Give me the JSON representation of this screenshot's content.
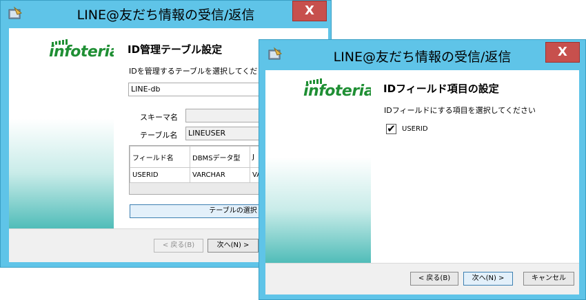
{
  "back_window": {
    "title": "LINE@友だち情報の受信/返信",
    "close_label": "X",
    "logo_text": "infoteria",
    "heading": "ID管理テーブル設定",
    "instruction": "IDを管理するテーブルを選択してくだ",
    "db_value": "LINE-db",
    "schema_label": "スキーマ名",
    "schema_value": "",
    "table_label": "テーブル名",
    "table_value": "LINEUSER",
    "grid": {
      "headers": [
        "フィールド名",
        "DBMSデータ型",
        "J"
      ],
      "rows": [
        [
          "USERID",
          "VARCHAR",
          "VA"
        ]
      ]
    },
    "select_table_button": "テーブルの選択",
    "back_button": "< 戻る(B)",
    "next_button": "次へ(N) >"
  },
  "front_window": {
    "title": "LINE@友だち情報の受信/返信",
    "close_label": "X",
    "logo_text": "infoteria",
    "heading": "IDフィールド項目の設定",
    "instruction": "IDフィールドにする項目を選択してください",
    "checkbox_label": "USERID",
    "checkbox_checked": true,
    "back_button": "< 戻る(B)",
    "next_button": "次へ(N) >",
    "cancel_button": "キャンセル"
  }
}
